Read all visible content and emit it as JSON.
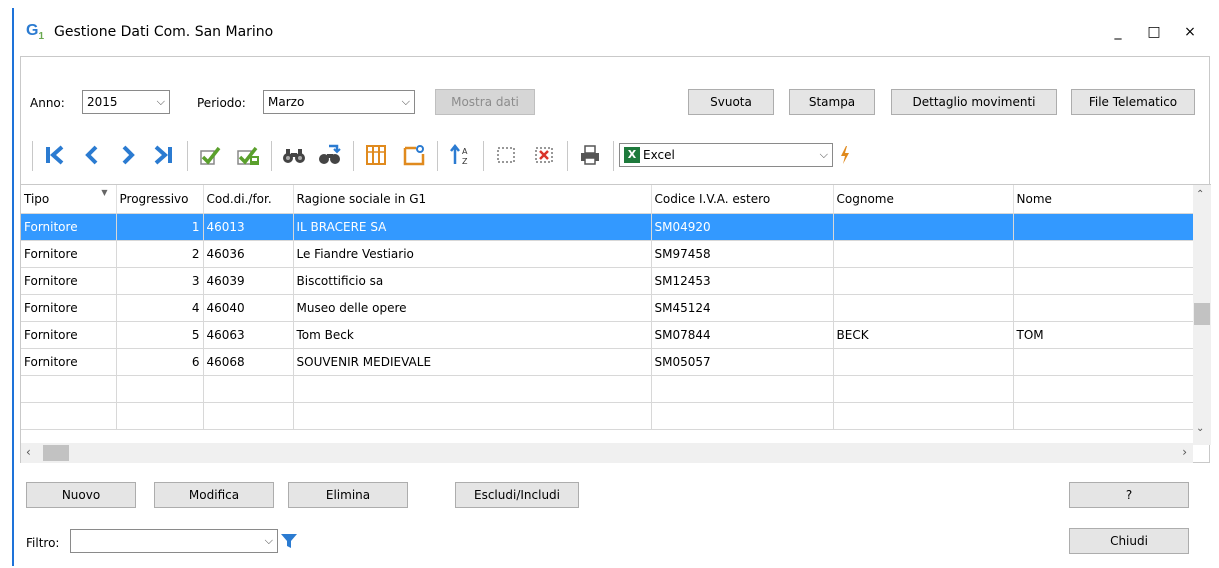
{
  "window": {
    "title": "Gestione Dati Com. San Marino",
    "icon_text": "G",
    "icon_suffix": "1",
    "minimize": "_",
    "maximize": "□",
    "close": "×"
  },
  "filters": {
    "anno_label": "Anno:",
    "anno_value": "2015",
    "periodo_label": "Periodo:",
    "periodo_value": "Marzo",
    "mostra_dati": "Mostra dati"
  },
  "top_buttons": {
    "svuota": "Svuota",
    "stampa": "Stampa",
    "dettaglio": "Dettaglio movimenti",
    "file_telematico": "File Telematico"
  },
  "toolbar": {
    "export_format": "Excel",
    "export_icon_letter": "X"
  },
  "grid": {
    "columns": [
      "Tipo",
      "Progressivo",
      "Cod.di./for.",
      "Ragione sociale in G1",
      "Codice I.V.A. estero",
      "Cognome",
      "Nome"
    ],
    "rows": [
      [
        "Fornitore",
        "1",
        "46013",
        "IL BRACERE SA",
        "SM04920",
        "",
        ""
      ],
      [
        "Fornitore",
        "2",
        "46036",
        "Le Fiandre Vestiario",
        "SM97458",
        "",
        ""
      ],
      [
        "Fornitore",
        "3",
        "46039",
        "Biscottificio sa",
        "SM12453",
        "",
        ""
      ],
      [
        "Fornitore",
        "4",
        "46040",
        "Museo delle opere",
        "SM45124",
        "",
        ""
      ],
      [
        "Fornitore",
        "5",
        "46063",
        "Tom Beck",
        "SM07844",
        "BECK",
        "TOM"
      ],
      [
        "Fornitore",
        "6",
        "46068",
        "SOUVENIR MEDIEVALE",
        "SM05057",
        "",
        ""
      ],
      [
        "",
        "",
        "",
        "",
        "",
        "",
        ""
      ],
      [
        "",
        "",
        "",
        "",
        "",
        "",
        ""
      ]
    ],
    "selected_row_index": 0
  },
  "bottom": {
    "nuovo": "Nuovo",
    "modifica": "Modifica",
    "elimina": "Elimina",
    "escludi_includi": "Escludi/Includi",
    "help": "?",
    "chiudi": "Chiudi",
    "filtro_label": "Filtro:",
    "filtro_value": ""
  },
  "colors": {
    "selection": "#3399ff",
    "accent_blue": "#2b7bd1",
    "check_green": "#5aa02c",
    "orange": "#e08a1e"
  }
}
